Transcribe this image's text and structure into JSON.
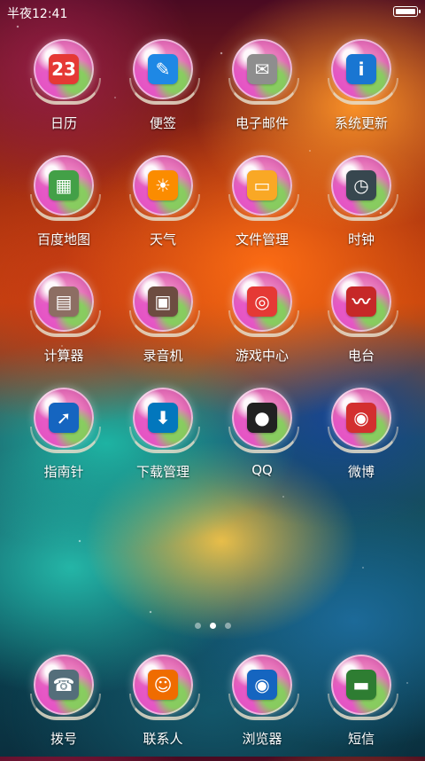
{
  "status_bar": {
    "time": "半夜12:41"
  },
  "apps": {
    "row1": [
      {
        "name": "calendar",
        "label": "日历",
        "glyph": "23",
        "color": "#e53935"
      },
      {
        "name": "notes",
        "label": "便签",
        "glyph": "✎",
        "color": "#1e88e5"
      },
      {
        "name": "email",
        "label": "电子邮件",
        "glyph": "✉",
        "color": "#8e8e8e"
      },
      {
        "name": "system-update",
        "label": "系统更新",
        "glyph": "i",
        "color": "#1976d2"
      }
    ],
    "row2": [
      {
        "name": "baidu-map",
        "label": "百度地图",
        "glyph": "▦",
        "color": "#43a047"
      },
      {
        "name": "weather",
        "label": "天气",
        "glyph": "☀",
        "color": "#fb8c00"
      },
      {
        "name": "file-manager",
        "label": "文件管理",
        "glyph": "▭",
        "color": "#f9a825"
      },
      {
        "name": "clock",
        "label": "时钟",
        "glyph": "◷",
        "color": "#37474f"
      }
    ],
    "row3": [
      {
        "name": "calculator",
        "label": "计算器",
        "glyph": "▤",
        "color": "#8d6e63"
      },
      {
        "name": "recorder",
        "label": "录音机",
        "glyph": "▣",
        "color": "#6d4c41"
      },
      {
        "name": "game-center",
        "label": "游戏中心",
        "glyph": "◎",
        "color": "#e53935"
      },
      {
        "name": "radio",
        "label": "电台",
        "glyph": "〰",
        "color": "#c62828"
      }
    ],
    "row4": [
      {
        "name": "compass",
        "label": "指南针",
        "glyph": "➚",
        "color": "#1565c0"
      },
      {
        "name": "download-manager",
        "label": "下载管理",
        "glyph": "⬇",
        "color": "#0277bd"
      },
      {
        "name": "qq",
        "label": "QQ",
        "glyph": "●",
        "color": "#212121"
      },
      {
        "name": "weibo",
        "label": "微博",
        "glyph": "◉",
        "color": "#d32f2f"
      }
    ],
    "dock": [
      {
        "name": "dialer",
        "label": "拨号",
        "glyph": "☎",
        "color": "#546e7a"
      },
      {
        "name": "contacts",
        "label": "联系人",
        "glyph": "☺",
        "color": "#ef6c00"
      },
      {
        "name": "browser",
        "label": "浏览器",
        "glyph": "◉",
        "color": "#1565c0"
      },
      {
        "name": "messages",
        "label": "短信",
        "glyph": "▬",
        "color": "#2e7d32"
      }
    ]
  },
  "page_indicator": {
    "count": 3,
    "active": 2
  }
}
